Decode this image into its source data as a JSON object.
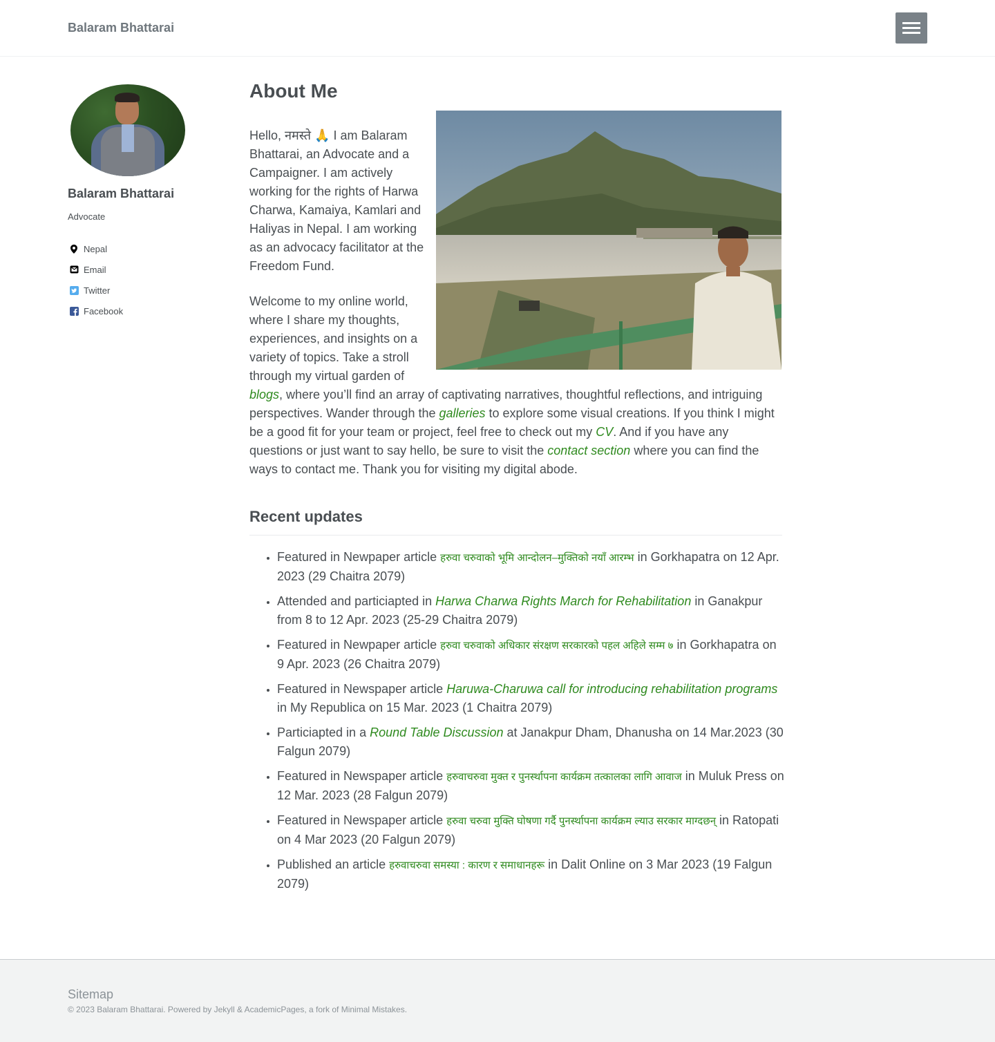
{
  "masthead": {
    "site_title": "Balaram Bhattarai"
  },
  "sidebar": {
    "name": "Balaram Bhattarai",
    "bio": "Advocate",
    "links": [
      {
        "icon": "map-marker-icon",
        "label": "Nepal"
      },
      {
        "icon": "envelope-icon",
        "label": "Email"
      },
      {
        "icon": "twitter-icon",
        "label": "Twitter"
      },
      {
        "icon": "facebook-icon",
        "label": "Facebook"
      }
    ]
  },
  "main": {
    "title": "About Me",
    "intro_p1": "Hello, नमस्ते 🙏 I am Balaram Bhattarai, an Advocate and a Campaigner. I am actively working for the rights of Harwa Charwa, Kamaiya, Kamlari and Haliyas in Nepal. I am working as an advocacy facilitator at the Freedom Fund.",
    "intro_p2": {
      "t1": "Welcome to my online world, where I share my thoughts, experiences, and insights on a variety of topics. Take a stroll through my virtual garden of ",
      "link1": "blogs",
      "t2": ", where you’ll find an array of captivating narratives, thoughtful reflections, and intriguing perspectives. Wander through the ",
      "link2": "galleries",
      "t3": " to explore some visual creations. If you think I might be a good fit for your team or project, feel free to check out my ",
      "link3": "CV",
      "t4": ". And if you have any questions or just want to say hello, be sure to visit the ",
      "link4": "contact section",
      "t5": " where you can find the ways to contact me. Thank you for visiting my digital abode."
    },
    "recent_title": "Recent updates",
    "updates": [
      {
        "pre": "Featured in Newpaper article ",
        "link": "हरुवा चरुवाको भूमि आन्दोलन–मुक्तिको नयाँ आरम्भ",
        "post": " in Gorkhapatra on 12 Apr. 2023 (29 Chaitra 2079)"
      },
      {
        "pre": "Attended and particiapted in ",
        "link": "Harwa Charwa Rights March for Rehabilitation",
        "post": " in Ganakpur from 8 to 12 Apr. 2023 (25-29 Chaitra 2079)"
      },
      {
        "pre": "Featured in Newpaper article ",
        "link": "हरुवा चरुवाको अधिकार संरक्षण सरकारको पहल अहिले सम्म ७",
        "post": " in Gorkhapatra on 9 Apr. 2023 (26 Chaitra 2079)"
      },
      {
        "pre": "Featured in Newspaper article ",
        "link": "Haruwa-Charuwa call for introducing rehabilitation programs",
        "post": " in My Republica on 15 Mar. 2023 (1 Chaitra 2079)"
      },
      {
        "pre": "Particiapted in a ",
        "link": "Round Table Discussion",
        "post": " at Janakpur Dham, Dhanusha on 14 Mar.2023 (30 Falgun 2079)"
      },
      {
        "pre": "Featured in Newspaper article ",
        "link": "हरुवाचरुवा मुक्त र पुनर्स्थापना कार्यक्रम तत्कालका लागि आवाज",
        "post": " in Muluk Press on 12 Mar. 2023 (28 Falgun 2079)"
      },
      {
        "pre": "Featured in Newspaper article ",
        "link": "हरुवा चरुवा मुक्ति घोषणा गर्दै पुनर्स्थापना कार्यक्रम ल्याउ सरकार माग्दछन्",
        "post": " in Ratopati on 4 Mar 2023 (20 Falgun 2079)"
      },
      {
        "pre": "Published an article ",
        "link": "हरुवाचरुवा समस्या : कारण र समाधानहरू",
        "post": " in Dalit Online on 3 Mar 2023 (19 Falgun 2079)"
      }
    ]
  },
  "footer": {
    "sitemap": "Sitemap",
    "copyright": "© 2023 Balaram Bhattarai. Powered by Jekyll & AcademicPages, a fork of Minimal Mistakes."
  },
  "colors": {
    "link": "#2f8a1f",
    "text": "#494e52",
    "menu_button": "#7a8288",
    "footer_bg": "#f2f3f3"
  }
}
